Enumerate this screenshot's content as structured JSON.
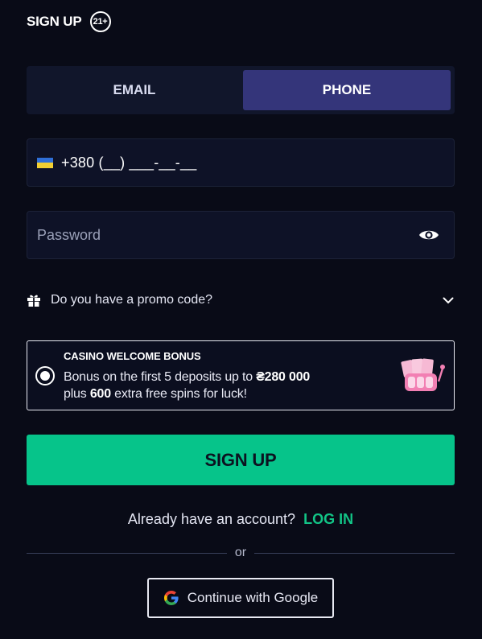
{
  "header": {
    "title": "SIGN UP",
    "age_badge": "21+"
  },
  "tabs": [
    {
      "label": "EMAIL",
      "active": false
    },
    {
      "label": "PHONE",
      "active": true
    }
  ],
  "phone": {
    "country_flag": "ukraine-flag-icon",
    "value": "+380 (__) ___-__-__"
  },
  "password": {
    "placeholder": "Password",
    "toggle_icon": "eye-icon"
  },
  "promo": {
    "label": "Do you have a promo code?",
    "icon": "gift-icon",
    "expand_icon": "chevron-down-icon"
  },
  "bonus": {
    "title": "CASINO WELCOME BONUS",
    "line1_prefix": "Bonus on the first 5 deposits up to ",
    "line1_amount": "₴280 000",
    "line2_prefix": "plus ",
    "line2_amount": "600",
    "line2_suffix": " extra free spins for luck!",
    "selected": true,
    "icon": "slot-machine-icon"
  },
  "signup_button": {
    "label": "SIGN UP",
    "color": "#06c48a"
  },
  "login": {
    "question": "Already have an account?",
    "link": "LOG IN",
    "link_color": "#12c486"
  },
  "divider": {
    "text": "or"
  },
  "google": {
    "label": "Continue with Google",
    "icon": "google-icon"
  },
  "colors": {
    "background": "#090b17",
    "tab_active": "#34357a",
    "accent": "#06c48a"
  }
}
